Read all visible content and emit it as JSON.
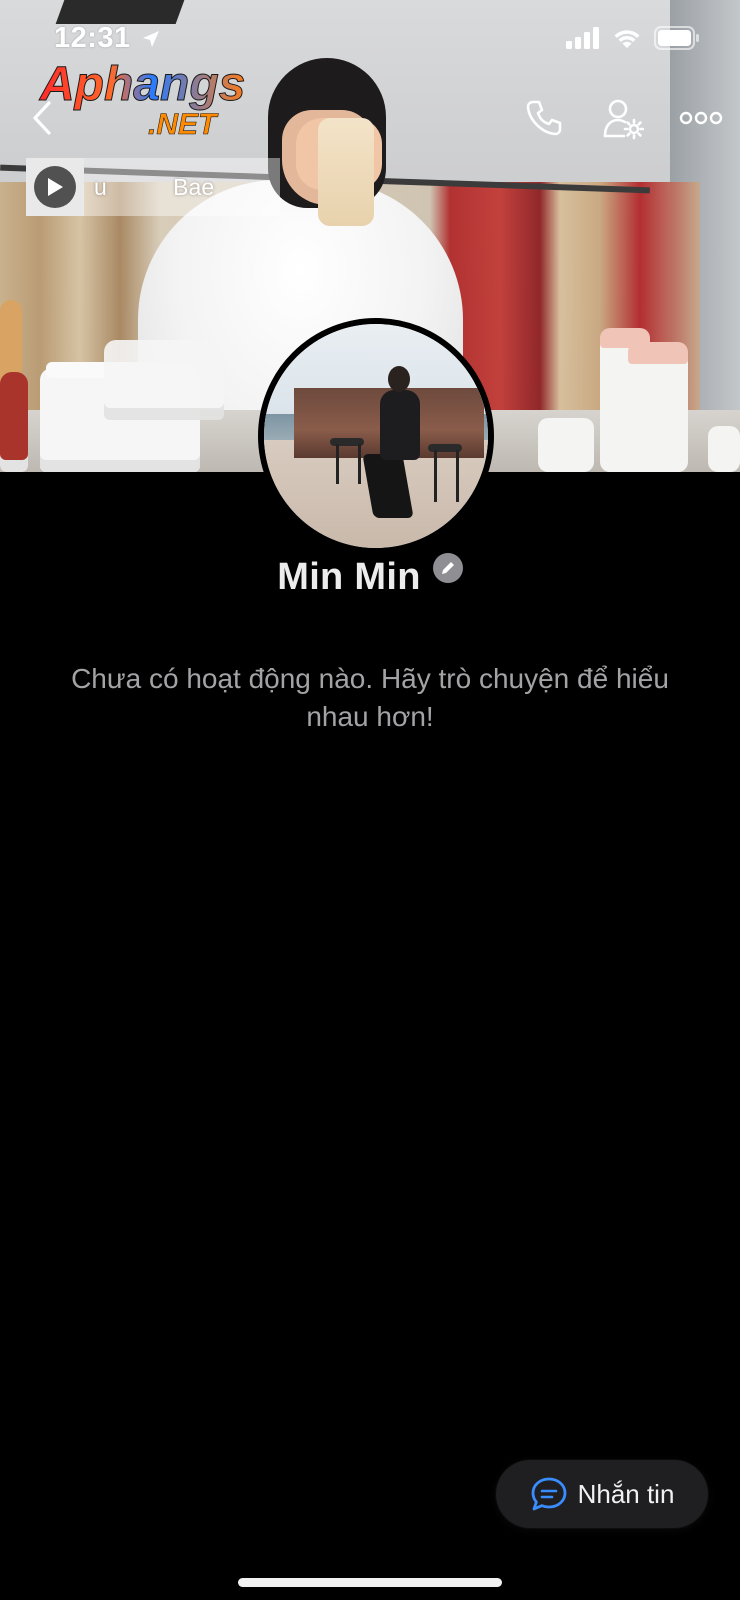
{
  "status_bar": {
    "time": "12:31"
  },
  "watermark": {
    "line1": "Aphangs",
    "line2": ".NET"
  },
  "music": {
    "title": "u Bae I Be"
  },
  "profile": {
    "name": "Min Min"
  },
  "empty_state": {
    "message": "Chưa có hoạt động nào. Hãy trò chuyện để hiểu nhau hơn!"
  },
  "message_button": {
    "label": "Nhắn tin"
  },
  "colors": {
    "accent": "#3a8dff",
    "background": "#000000",
    "secondary_text": "#a3a3a6"
  },
  "icons": {
    "back": "chevron-left-icon",
    "call": "phone-icon",
    "friend_settings": "user-gear-icon",
    "more": "more-dots-icon",
    "edit": "pencil-icon",
    "chat": "chat-bubble-icon"
  }
}
